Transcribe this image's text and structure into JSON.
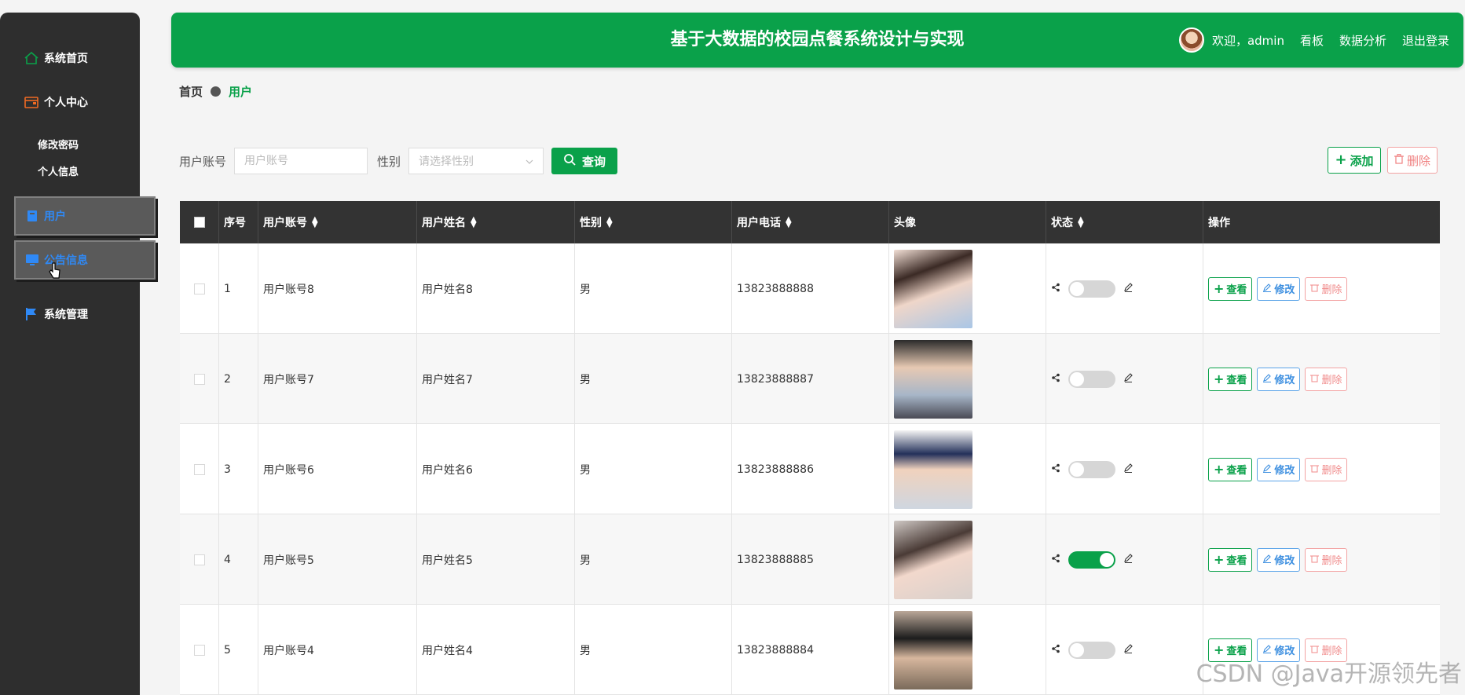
{
  "header": {
    "title": "基于大数据的校园点餐系统设计与实现",
    "welcome": "欢迎，admin",
    "links": [
      "看板",
      "数据分析",
      "退出登录"
    ]
  },
  "sidebar": {
    "home": "系统首页",
    "personal_center": "个人中心",
    "sub_items": [
      "修改密码",
      "个人信息"
    ],
    "card_items": [
      "用户",
      "公告信息"
    ],
    "system_admin": "系统管理"
  },
  "breadcrumb": {
    "home": "首页",
    "current": "用户"
  },
  "search": {
    "account_label": "用户账号",
    "account_placeholder": "用户账号",
    "gender_label": "性别",
    "gender_placeholder": "请选择性别",
    "query_label": "查询",
    "add_label": "添加",
    "delete_label": "删除"
  },
  "table": {
    "headers": [
      "序号",
      "用户账号",
      "用户姓名",
      "性别",
      "用户电话",
      "头像",
      "状态",
      "操作"
    ],
    "actions": {
      "view": "查看",
      "edit": "修改",
      "delete": "删除"
    },
    "rows": [
      {
        "index": "1",
        "account": "用户账号8",
        "name": "用户姓名8",
        "gender": "男",
        "phone": "13823888888",
        "status_on": false
      },
      {
        "index": "2",
        "account": "用户账号7",
        "name": "用户姓名7",
        "gender": "男",
        "phone": "13823888887",
        "status_on": false
      },
      {
        "index": "3",
        "account": "用户账号6",
        "name": "用户姓名6",
        "gender": "男",
        "phone": "13823888886",
        "status_on": false
      },
      {
        "index": "4",
        "account": "用户账号5",
        "name": "用户姓名5",
        "gender": "男",
        "phone": "13823888885",
        "status_on": true
      },
      {
        "index": "5",
        "account": "用户账号4",
        "name": "用户姓名4",
        "gender": "男",
        "phone": "13823888884",
        "status_on": false
      }
    ]
  },
  "colors": {
    "accent": "#0aa14a",
    "sidebar": "#2e2e2e",
    "header_table": "#333333"
  },
  "watermark": "CSDN @Java开源领先者"
}
